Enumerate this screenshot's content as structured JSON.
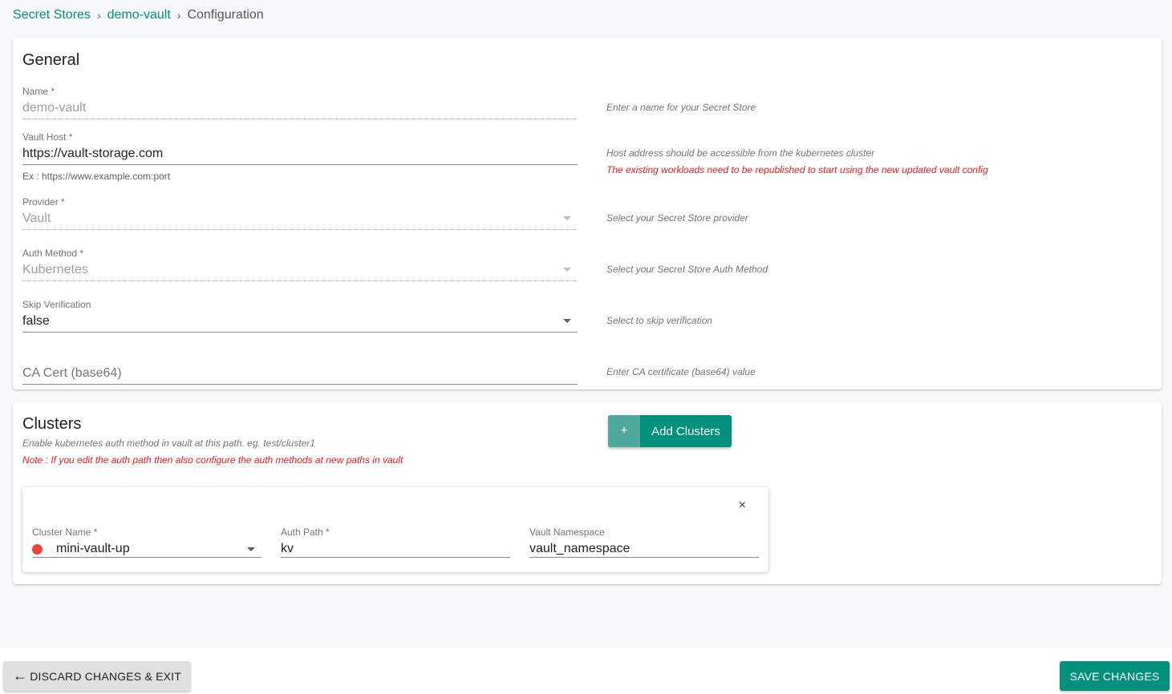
{
  "breadcrumb": {
    "items": [
      "Secret Stores",
      "demo-vault"
    ],
    "current": "Configuration",
    "separator": "›"
  },
  "general": {
    "title": "General",
    "fields": {
      "name": {
        "label": "Name *",
        "value": "demo-vault",
        "hint": "Enter a name for your Secret Store"
      },
      "vault_host": {
        "label": "Vault Host *",
        "value": "https://vault-storage.com",
        "helper": "Ex : https://www.example.com:port",
        "hint": "Host address should be accessible from the kubernetes cluster",
        "warning": "The existing workloads need to be republished to start using the new updated vault config"
      },
      "provider": {
        "label": "Provider *",
        "value": "Vault",
        "hint": "Select your Secret Store provider"
      },
      "auth_method": {
        "label": "Auth Method *",
        "value": "Kubernetes",
        "hint": "Select your Secret Store Auth Method"
      },
      "skip_verification": {
        "label": "Skip Verification",
        "value": "false",
        "hint": "Select to skip verification"
      },
      "ca_cert": {
        "placeholder": "CA Cert (base64)",
        "hint": "Enter CA certificate (base64) value"
      }
    }
  },
  "clusters": {
    "title": "Clusters",
    "hint": "Enable kubernetes auth method in vault at this path. eg. test/cluster1",
    "note": "Note : If you edit the auth path then also configure the auth methods at new paths in vault",
    "add_button": {
      "icon": "+",
      "label": "Add Clusters"
    },
    "items": [
      {
        "cluster_name_label": "Cluster Name *",
        "cluster_name": "mini-vault-up",
        "status_color": "#f44336",
        "auth_path_label": "Auth Path *",
        "auth_path": "kv",
        "vault_namespace_label": "Vault Namespace",
        "vault_namespace": "vault_namespace",
        "close_icon": "×"
      }
    ]
  },
  "footer": {
    "discard_label": "DISCARD CHANGES & EXIT",
    "discard_icon": "←",
    "save_label": "SAVE CHANGES"
  },
  "colors": {
    "accent": "#00917c",
    "error": "#f21c1c"
  }
}
